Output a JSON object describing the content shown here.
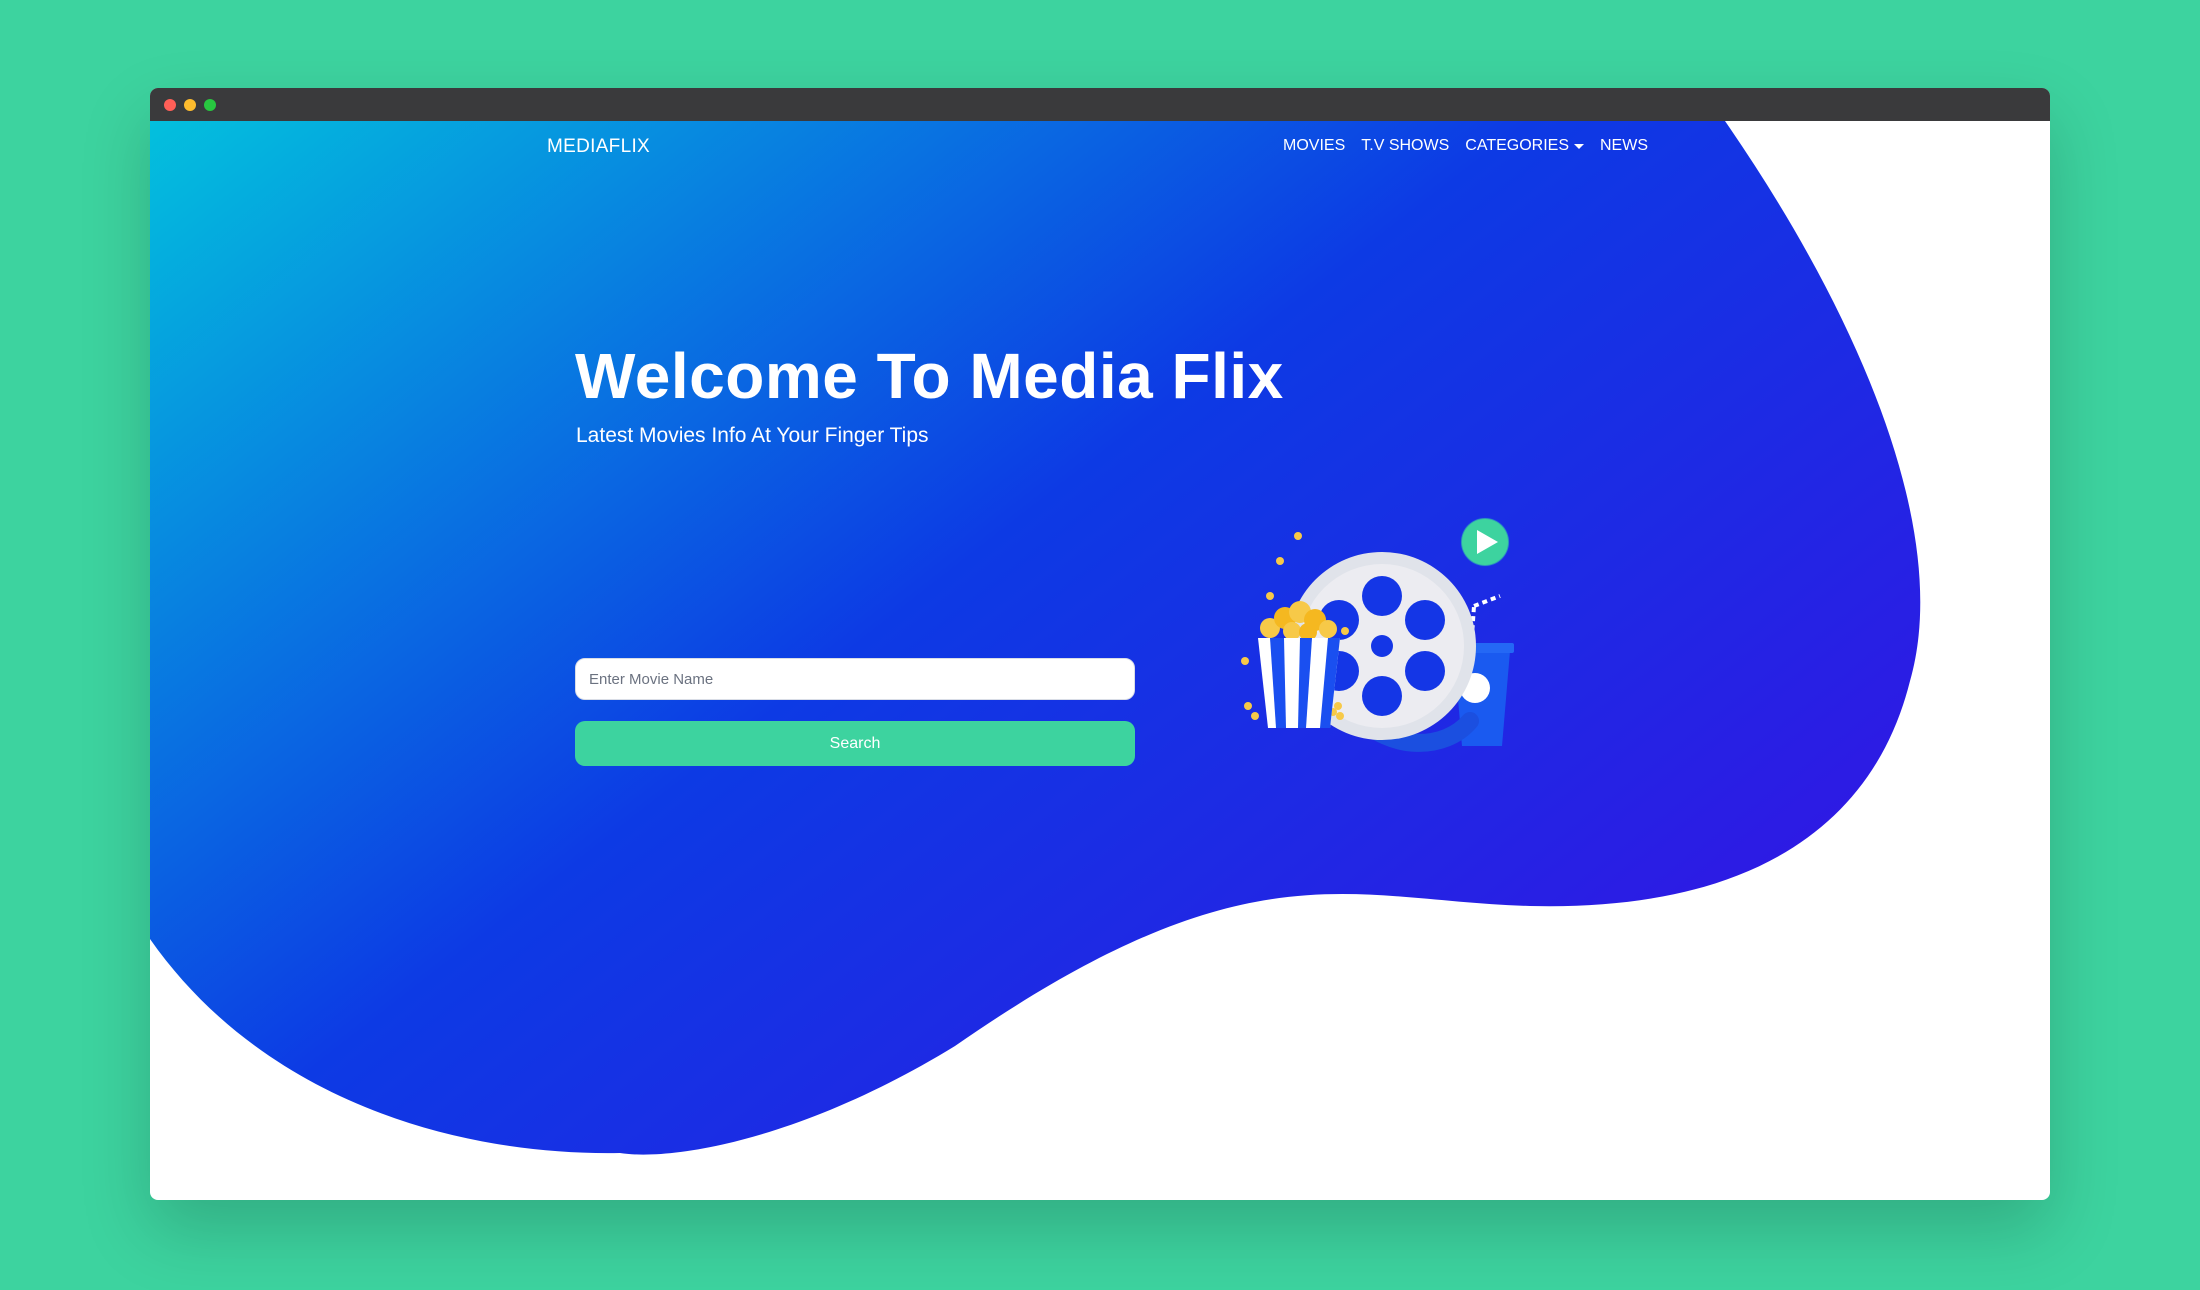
{
  "colors": {
    "page_background": "#3dd39f",
    "hero_gradient_start": "#03c0dd",
    "hero_gradient_mid": "#0d3ae4",
    "hero_gradient_end": "#3216e4",
    "accent": "#3dd39f",
    "titlebar": "#3a3a3c"
  },
  "window": {
    "controls": [
      "close-dot",
      "minimize-dot",
      "maximize-dot"
    ]
  },
  "navbar": {
    "brand": "MEDIAFLIX",
    "links": [
      {
        "label": "MOVIES"
      },
      {
        "label": "T.V SHOWS"
      },
      {
        "label": "CATEGORIES",
        "has_dropdown": true
      },
      {
        "label": "NEWS"
      }
    ]
  },
  "hero": {
    "title": "Welcome To Media Flix",
    "subtitle": "Latest Movies Info At Your Finger Tips"
  },
  "search": {
    "value": "",
    "placeholder": "Enter Movie Name",
    "button_label": "Search"
  },
  "illustration": {
    "icons": [
      "popcorn-icon",
      "film-reel-icon",
      "soda-cup-icon",
      "play-button-icon"
    ]
  }
}
